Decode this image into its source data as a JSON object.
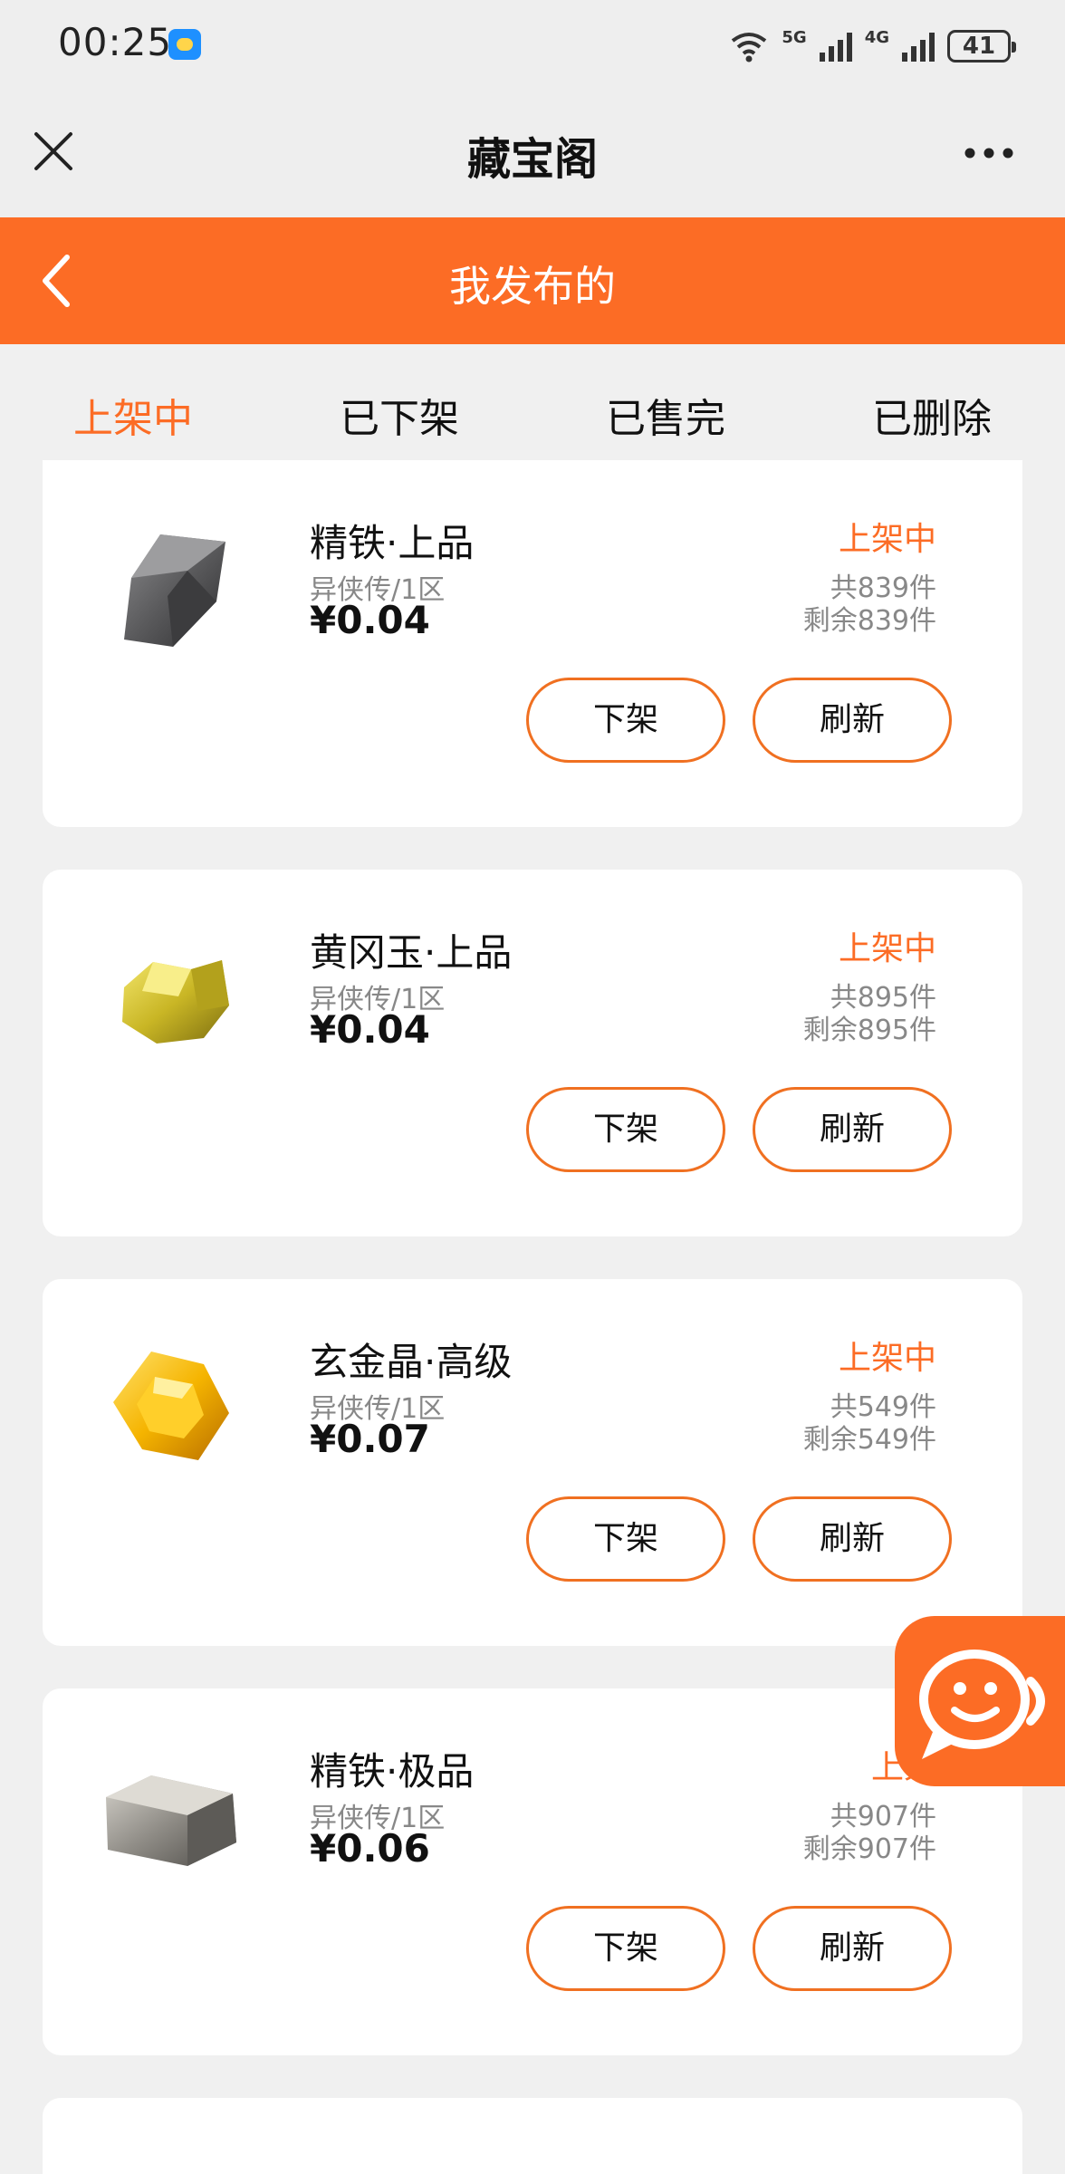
{
  "status_bar": {
    "time": "00:25",
    "net_5g": "5G",
    "net_4g": "4G",
    "battery": "41"
  },
  "title_bar": {
    "title": "藏宝阁",
    "close_icon": "close-icon",
    "more_icon": "more-icon"
  },
  "header": {
    "title": "我发布的",
    "back_icon": "chevron-left-icon"
  },
  "tabs": [
    {
      "label": "上架中",
      "active": true
    },
    {
      "label": "已下架",
      "active": false
    },
    {
      "label": "已售完",
      "active": false
    },
    {
      "label": "已删除",
      "active": false
    }
  ],
  "items": [
    {
      "name": "精铁·上品",
      "region": "异侠传/1区",
      "price": "¥0.04",
      "status": "上架中",
      "total": "共839件",
      "remain": "剩余839件",
      "off_label": "下架",
      "refresh_label": "刷新",
      "icon": "iron-ore-icon"
    },
    {
      "name": "黄冈玉·上品",
      "region": "异侠传/1区",
      "price": "¥0.04",
      "status": "上架中",
      "total": "共895件",
      "remain": "剩余895件",
      "off_label": "下架",
      "refresh_label": "刷新",
      "icon": "jade-ore-icon"
    },
    {
      "name": "玄金晶·高级",
      "region": "异侠传/1区",
      "price": "¥0.07",
      "status": "上架中",
      "total": "共549件",
      "remain": "剩余549件",
      "off_label": "下架",
      "refresh_label": "刷新",
      "icon": "gold-crystal-icon"
    },
    {
      "name": "精铁·极品",
      "region": "异侠传/1区",
      "price": "¥0.06",
      "status": "上架",
      "total": "共907件",
      "remain": "剩余907件",
      "off_label": "下架",
      "refresh_label": "刷新",
      "icon": "iron-ingot-icon"
    }
  ],
  "colors": {
    "accent": "#fc6c25",
    "background": "#f0f0f0",
    "card": "#ffffff",
    "muted_text": "#888888"
  },
  "chat_fab_icon": "chat-smile-icon"
}
